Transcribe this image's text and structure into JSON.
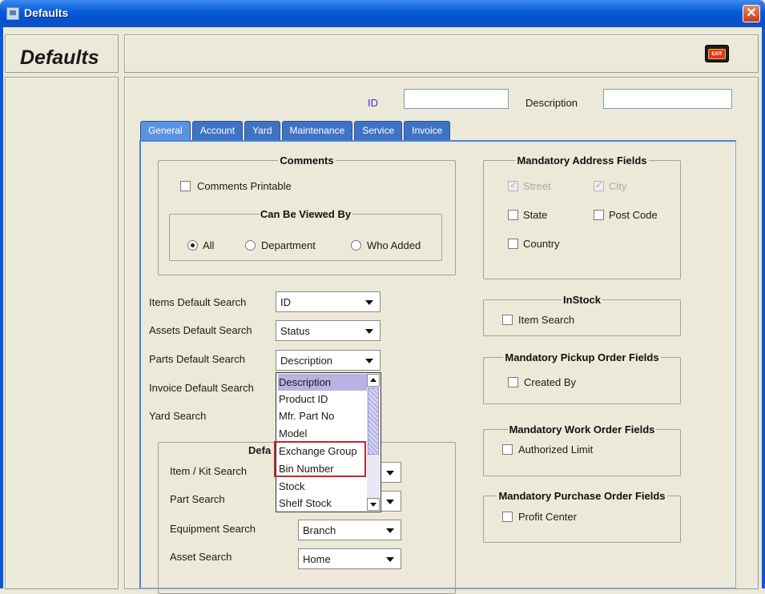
{
  "window": {
    "title": "Defaults",
    "close_glyph": "✕"
  },
  "header": {
    "title": "Defaults",
    "exit_label": "EXIT"
  },
  "top_fields": {
    "id_label": "ID",
    "id_value": "",
    "description_label": "Description",
    "description_value": ""
  },
  "tabs": [
    {
      "label": "General",
      "active": true
    },
    {
      "label": "Account"
    },
    {
      "label": "Yard"
    },
    {
      "label": "Maintenance"
    },
    {
      "label": "Service"
    },
    {
      "label": "Invoice"
    }
  ],
  "comments": {
    "title": "Comments",
    "printable_label": "Comments Printable",
    "viewed_by": {
      "title": "Can Be Viewed By",
      "options": [
        "All",
        "Department",
        "Who Added"
      ],
      "selected": "All"
    }
  },
  "searches": [
    {
      "label": "Items Default Search",
      "value": "ID"
    },
    {
      "label": "Assets Default Search",
      "value": "Status"
    },
    {
      "label": "Parts Default Search",
      "value": "Description"
    },
    {
      "label": "Invoice Default Search",
      "value": ""
    },
    {
      "label": "Yard Search",
      "value": ""
    }
  ],
  "dropdown": {
    "items": [
      "Description",
      "Product ID",
      "Mfr. Part No",
      "Model",
      "Exchange Group",
      "Bin Number",
      "Stock",
      "Shelf Stock"
    ],
    "selected": "Description",
    "highlighted": [
      "Exchange Group",
      "Bin Number"
    ]
  },
  "default_group": {
    "title_visible": "Defa",
    "rows": [
      {
        "label": "Item / Kit Search",
        "value": ""
      },
      {
        "label": "Part Search",
        "value": ""
      },
      {
        "label": "Equipment Search",
        "value": "Branch"
      },
      {
        "label": "Asset Search",
        "value": "Home"
      }
    ]
  },
  "mandatory_address": {
    "title": "Mandatory Address Fields",
    "fields": [
      {
        "label": "Street",
        "checked": true,
        "disabled": true
      },
      {
        "label": "City",
        "checked": true,
        "disabled": true
      },
      {
        "label": "State",
        "checked": false
      },
      {
        "label": "Post Code",
        "checked": false
      },
      {
        "label": "Country",
        "checked": false
      }
    ]
  },
  "instock": {
    "title": "InStock",
    "item_search_label": "Item Search"
  },
  "pickup": {
    "title": "Mandatory Pickup Order Fields",
    "created_by_label": "Created By"
  },
  "work_order": {
    "title": "Mandatory Work Order Fields",
    "authorized_limit_label": "Authorized Limit"
  },
  "purchase_order": {
    "title": "Mandatory Purchase Order Fields",
    "profit_center_label": "Profit Center"
  },
  "colors": {
    "titlebar": "#0a5fd8",
    "tab": "#3e73c4",
    "active_tab": "#5a93e2",
    "highlight_border": "#c6262e",
    "list_selection": "#b8b3e0"
  }
}
